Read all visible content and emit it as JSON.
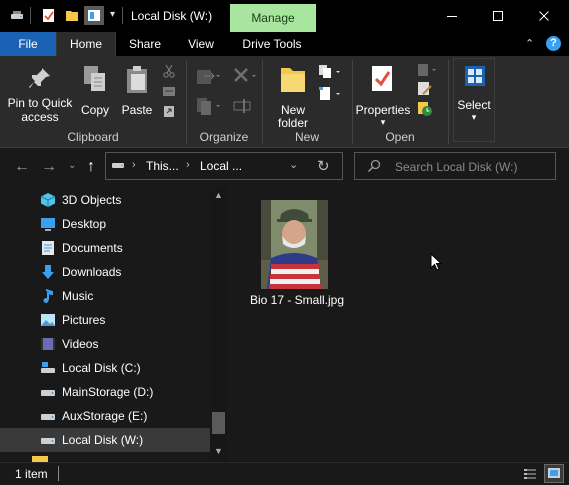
{
  "window": {
    "title": "Local Disk (W:)",
    "contextual_tab": "Manage",
    "contextual_tab_color": "#a8e6a0"
  },
  "ribbon_tabs": {
    "file": "File",
    "home": "Home",
    "share": "Share",
    "view": "View",
    "drive_tools": "Drive Tools"
  },
  "ribbon": {
    "clipboard": {
      "pin_to_quick_access_line1": "Pin to Quick",
      "pin_to_quick_access_line2": "access",
      "copy": "Copy",
      "paste": "Paste",
      "group_label": "Clipboard"
    },
    "organize": {
      "group_label": "Organize"
    },
    "new": {
      "new_folder_line1": "New",
      "new_folder_line2": "folder",
      "group_label": "New"
    },
    "open": {
      "properties": "Properties",
      "group_label": "Open"
    },
    "select": {
      "label": "Select"
    }
  },
  "navigation": {
    "breadcrumb": [
      "This...",
      "Local ..."
    ],
    "search_placeholder": "Search Local Disk (W:)"
  },
  "nav_pane": {
    "items": [
      {
        "label": "3D Objects",
        "icon": "3d-objects-icon"
      },
      {
        "label": "Desktop",
        "icon": "desktop-icon"
      },
      {
        "label": "Documents",
        "icon": "documents-icon"
      },
      {
        "label": "Downloads",
        "icon": "downloads-icon"
      },
      {
        "label": "Music",
        "icon": "music-icon"
      },
      {
        "label": "Pictures",
        "icon": "pictures-icon"
      },
      {
        "label": "Videos",
        "icon": "videos-icon"
      },
      {
        "label": "Local Disk (C:)",
        "icon": "local-disk-icon"
      },
      {
        "label": "MainStorage (D:)",
        "icon": "drive-icon"
      },
      {
        "label": "AuxStorage (E:)",
        "icon": "drive-icon"
      },
      {
        "label": "Local Disk (W:)",
        "icon": "drive-icon",
        "selected": true
      }
    ]
  },
  "content": {
    "files": [
      {
        "name": "Bio 17 - Small.jpg",
        "type": "image-thumbnail"
      }
    ]
  },
  "status": {
    "item_count": "1 item"
  },
  "colors": {
    "file_tab": "#1a63b4",
    "background": "#191919",
    "ribbon": "#2b2b2b",
    "accent_blue": "#3aa0f0"
  }
}
